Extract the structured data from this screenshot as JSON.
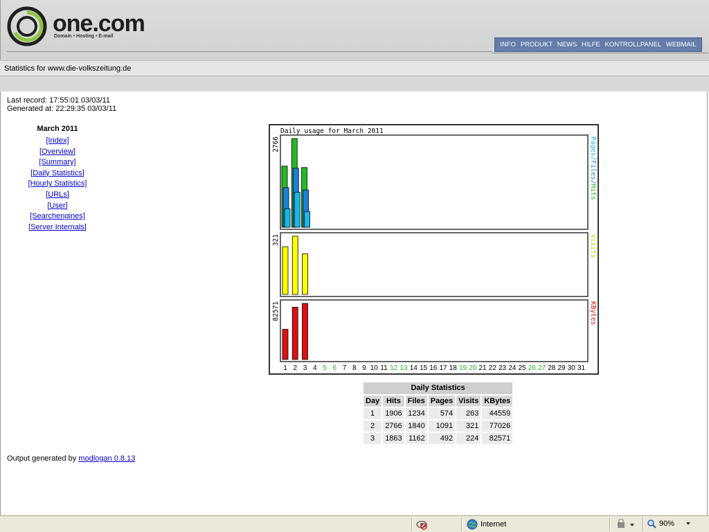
{
  "brand": {
    "name": "one.com",
    "tagline": "Domain • Hosting • E-mail"
  },
  "topnav": [
    "INFO",
    "PRODUKT",
    "NEWS",
    "HILFE",
    "KONTROLLPANEL",
    "WEBMAIL"
  ],
  "stats_for": "Statistics for www.die-volkszeitung.de",
  "meta": {
    "last_record": "Last record: 17:55:01 03/03/11",
    "generated_at": "Generated at: 22:29:35 03/03/11"
  },
  "sidenav": {
    "month": "March 2011",
    "links": [
      "[Index]",
      "[Overview]",
      "[Summary]",
      "[Daily Statistics]",
      "[Hourly Statistics]",
      "[URLs]",
      "[User]",
      "[Searchengines]",
      "[Server Internals]"
    ]
  },
  "chart_data": {
    "type": "bar",
    "title": "Daily usage for March 2011",
    "categories": [
      "1",
      "2",
      "3",
      "4",
      "5",
      "6",
      "7",
      "8",
      "9",
      "10",
      "11",
      "12",
      "13",
      "14",
      "15",
      "16",
      "17",
      "18",
      "19",
      "20",
      "21",
      "22",
      "23",
      "24",
      "25",
      "26",
      "27",
      "28",
      "29",
      "30",
      "31"
    ],
    "weekend_days": [
      "5",
      "6",
      "12",
      "13",
      "19",
      "20",
      "26",
      "27"
    ],
    "colors": {
      "hits": "#22bb22",
      "files": "#1e7fd8",
      "pages": "#1ab8e8",
      "visits": "#ffff00",
      "kbytes": "#dd1111",
      "weekend": "#22bb22"
    },
    "panels": [
      {
        "label": "Pages/Files/Hits",
        "max_label": "2766",
        "ylim": [
          0,
          2766
        ],
        "series": [
          {
            "name": "Hits",
            "values": [
              1906,
              2766,
              1863
            ]
          },
          {
            "name": "Files",
            "values": [
              1234,
              1840,
              1162
            ]
          },
          {
            "name": "Pages",
            "values": [
              574,
              1091,
              492
            ]
          }
        ]
      },
      {
        "label": "Visits",
        "max_label": "321",
        "ylim": [
          0,
          321
        ],
        "series": [
          {
            "name": "Visits",
            "values": [
              263,
              321,
              224
            ]
          }
        ]
      },
      {
        "label": "KBytes",
        "max_label": "82571",
        "ylim": [
          0,
          82571
        ],
        "series": [
          {
            "name": "KBytes",
            "values": [
              44559,
              77026,
              82571
            ]
          }
        ]
      }
    ]
  },
  "table": {
    "caption": "Daily Statistics",
    "headers": [
      "Day",
      "Hits",
      "Files",
      "Pages",
      "Visits",
      "KBytes"
    ],
    "rows": [
      [
        "1",
        "1906",
        "1234",
        "574",
        "263",
        "44559"
      ],
      [
        "2",
        "2766",
        "1840",
        "1091",
        "321",
        "77026"
      ],
      [
        "3",
        "1863",
        "1162",
        "492",
        "224",
        "82571"
      ]
    ]
  },
  "footer": {
    "prefix": "Output generated by ",
    "link": "modlogan 0.8.13"
  },
  "statusbar": {
    "zone": "Internet",
    "zoom": "90%"
  }
}
